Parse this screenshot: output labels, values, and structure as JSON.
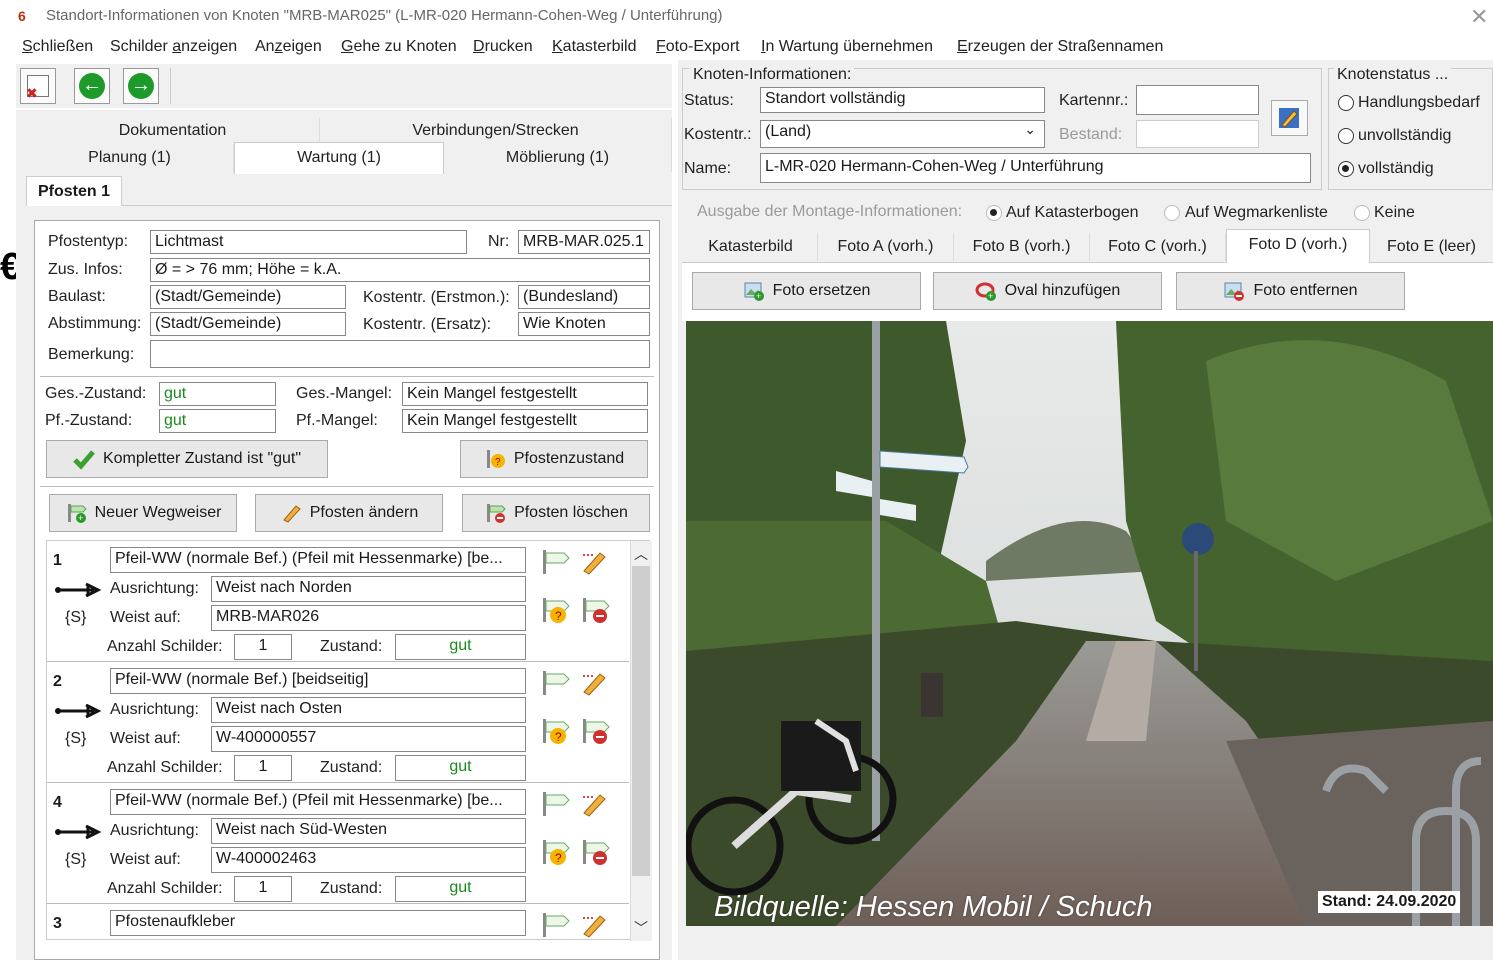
{
  "window": {
    "title": "Standort-Informationen von Knoten \"MRB-MAR025\" (L-MR-020 Hermann-Cohen-Weg / Unterführung)",
    "icon_text": "6",
    "close_glyph": "✕"
  },
  "menu": [
    {
      "underline": "S",
      "rest": "chließen"
    },
    {
      "pre": "Schilder ",
      "underline": "a",
      "rest": "nzeigen"
    },
    {
      "pre": "An",
      "underline": "z",
      "rest": "eigen"
    },
    {
      "underline": "G",
      "rest": "ehe zu Knoten"
    },
    {
      "underline": "D",
      "rest": "rucken"
    },
    {
      "underline": "K",
      "rest": "atasterbild"
    },
    {
      "underline": "F",
      "rest": "oto-Export"
    },
    {
      "underline": "I",
      "rest": "n Wartung übernehmen"
    },
    {
      "underline": "E",
      "rest": "rzeugen der Straßennamen"
    }
  ],
  "edge_char": "€",
  "left": {
    "tabs_row1": [
      "Dokumentation",
      "Verbindungen/Strecken"
    ],
    "tabs_row2": [
      "Planung (1)",
      "Wartung (1)",
      "Möblierung (1)"
    ],
    "subtab": "Pfosten 1",
    "pfostentyp_label": "Pfostentyp:",
    "pfostentyp": "Lichtmast",
    "nr_label": "Nr:",
    "nr": "MRB-MAR.025.1",
    "zus_label": "Zus. Infos:",
    "zus": "Ø = > 76 mm; Höhe = k.A.",
    "baulast_label": "Baulast:",
    "baulast": "(Stadt/Gemeinde)",
    "kost_erst_label": "Kostentr. (Erstmon.):",
    "kost_erst": "(Bundesland)",
    "abst_label": "Abstimmung:",
    "abst": "(Stadt/Gemeinde)",
    "kost_ersatz_label": "Kostentr. (Ersatz):",
    "kost_ersatz": "Wie Knoten",
    "bemerkung_label": "Bemerkung:",
    "bemerkung": "",
    "ges_zustand_label": "Ges.-Zustand:",
    "ges_zustand": "gut",
    "ges_mangel_label": "Ges.-Mangel:",
    "ges_mangel": "Kein Mangel festgestellt",
    "pf_zustand_label": "Pf.-Zustand:",
    "pf_zustand": "gut",
    "pf_mangel_label": "Pf.-Mangel:",
    "pf_mangel": "Kein Mangel festgestellt",
    "btn_komplett": "Kompletter Zustand ist \"gut\"",
    "btn_pfostenzustand": "Pfostenzustand",
    "btn_neuer": "Neuer Wegweiser",
    "btn_aendern": "Pfosten ändern",
    "btn_loeschen": "Pfosten löschen",
    "row_labels": {
      "ausrichtung": "Ausrichtung:",
      "weist": "Weist auf:",
      "anzahl": "Anzahl Schilder:",
      "zustand": "Zustand:",
      "s": "{S}"
    },
    "rows": [
      {
        "num": "1",
        "typ": "Pfeil-WW (normale Bef.) (Pfeil mit Hessenmarke) [be...",
        "ausrichtung": "Weist nach Norden",
        "weist": "MRB-MAR026",
        "anzahl": "1",
        "zustand": "gut"
      },
      {
        "num": "2",
        "typ": "Pfeil-WW (normale Bef.) [beidseitig]",
        "ausrichtung": "Weist nach Osten",
        "weist": "W-400000557",
        "anzahl": "1",
        "zustand": "gut"
      },
      {
        "num": "4",
        "typ": "Pfeil-WW (normale Bef.) (Pfeil mit Hessenmarke) [be...",
        "ausrichtung": "Weist nach Süd-Westen",
        "weist": "W-400002463",
        "anzahl": "1",
        "zustand": "gut"
      },
      {
        "num": "3",
        "typ": "Pfostenaufkleber"
      }
    ]
  },
  "right": {
    "knoten_title": "Knoten-Informationen:",
    "status_label": "Status:",
    "status": "Standort vollständig",
    "kartennr_label": "Kartennr.:",
    "kartennr": "",
    "kostentr_label": "Kostentr.:",
    "kostentr": "(Land)",
    "bestand_label": "Bestand:",
    "bestand": "",
    "name_label": "Name:",
    "name": "L-MR-020 Hermann-Cohen-Weg / Unterführung",
    "knotenstatus_title": "Knotenstatus ...",
    "knotenstatus_options": [
      "Handlungsbedarf",
      "unvollständig",
      "vollständig"
    ],
    "knotenstatus_selected": "vollständig",
    "ausgabe_label": "Ausgabe der Montage-Informationen:",
    "ausgabe_options": [
      "Auf Katasterbogen",
      "Auf Wegmarkenliste",
      "Keine"
    ],
    "photo_tabs": [
      "Katasterbild",
      "Foto A (vorh.)",
      "Foto B (vorh.)",
      "Foto C (vorh.)",
      "Foto D (vorh.)",
      "Foto E (leer)"
    ],
    "photo_tab_active": "Foto D (vorh.)",
    "btn_ersetzen": "Foto ersetzen",
    "btn_oval": "Oval hinzufügen",
    "btn_entfernen": "Foto entfernen",
    "caption": "Bildquelle: Hessen Mobil / Schuch",
    "stand": "Stand: 24.09.2020"
  }
}
